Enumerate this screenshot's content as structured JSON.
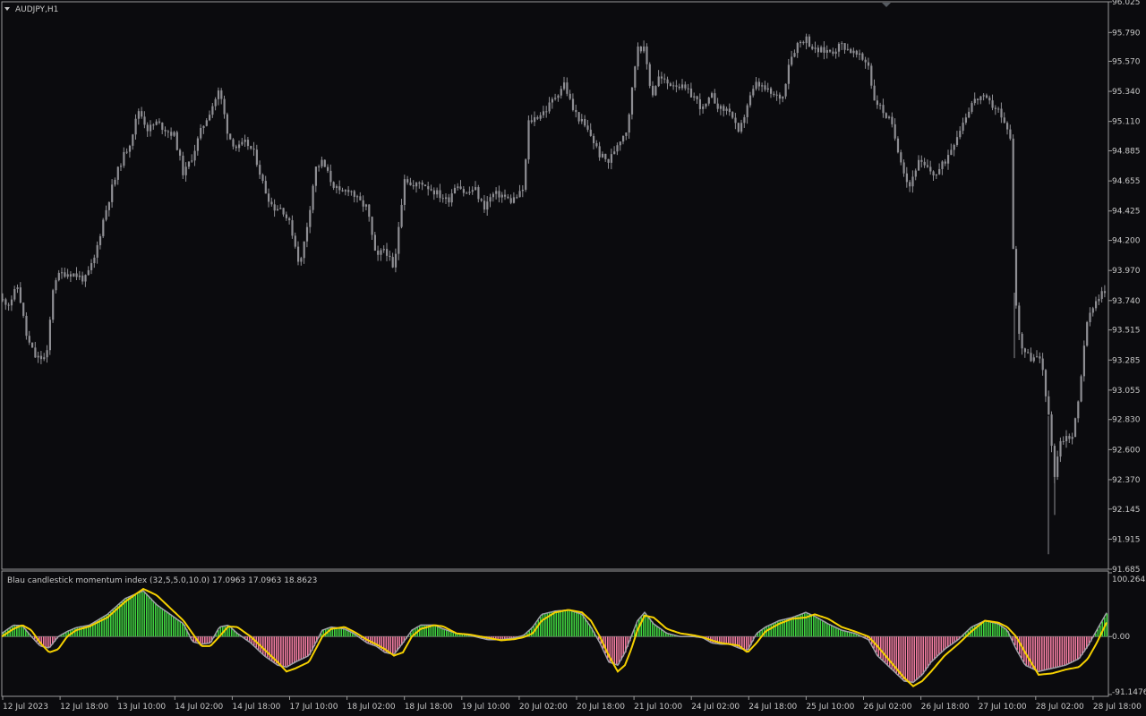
{
  "colors": {
    "background": "#0b0b0e",
    "frame": "#9a9a9a",
    "candle": "#8e8e93",
    "text": "#c8c8c8",
    "hist_pos": "#3fd23f",
    "hist_neg": "#f07ca0",
    "line_main": "#a0a0a8",
    "line_signal": "#f5d000"
  },
  "header": {
    "symbol_label": "AUDJPY,H1",
    "indicator_label": "Blau candlestick momentum index (32,5,5.0,10.0) 17.0963 17.0963 18.8623"
  },
  "chart_data": [
    {
      "type": "candlestick",
      "symbol": "AUDJPY",
      "timeframe": "H1",
      "ylim": [
        91.685,
        96.025
      ],
      "y_ticks": [
        "96.025",
        "95.790",
        "95.570",
        "95.340",
        "95.110",
        "94.885",
        "94.655",
        "94.425",
        "94.200",
        "93.970",
        "93.740",
        "93.515",
        "93.285",
        "93.055",
        "92.830",
        "92.600",
        "92.370",
        "92.145",
        "91.915",
        "91.685"
      ],
      "close_path": [
        [
          0,
          93.75
        ],
        [
          10,
          93.72
        ],
        [
          20,
          93.85
        ],
        [
          30,
          93.45
        ],
        [
          40,
          93.3
        ],
        [
          52,
          93.3
        ],
        [
          60,
          93.9
        ],
        [
          70,
          93.95
        ],
        [
          80,
          93.95
        ],
        [
          95,
          93.9
        ],
        [
          105,
          94.05
        ],
        [
          115,
          94.35
        ],
        [
          125,
          94.6
        ],
        [
          135,
          94.8
        ],
        [
          145,
          94.95
        ],
        [
          155,
          95.2
        ],
        [
          165,
          95.05
        ],
        [
          175,
          95.1
        ],
        [
          185,
          95.05
        ],
        [
          195,
          95.0
        ],
        [
          205,
          94.7
        ],
        [
          215,
          94.85
        ],
        [
          225,
          95.05
        ],
        [
          235,
          95.2
        ],
        [
          245,
          95.35
        ],
        [
          255,
          95.0
        ],
        [
          265,
          94.9
        ],
        [
          275,
          94.95
        ],
        [
          285,
          94.85
        ],
        [
          295,
          94.6
        ],
        [
          305,
          94.45
        ],
        [
          315,
          94.45
        ],
        [
          325,
          94.3
        ],
        [
          335,
          94.0
        ],
        [
          345,
          94.4
        ],
        [
          352,
          94.75
        ],
        [
          360,
          94.8
        ],
        [
          370,
          94.65
        ],
        [
          380,
          94.55
        ],
        [
          390,
          94.6
        ],
        [
          400,
          94.5
        ],
        [
          410,
          94.45
        ],
        [
          420,
          94.05
        ],
        [
          430,
          94.15
        ],
        [
          440,
          93.95
        ],
        [
          445,
          94.3
        ],
        [
          452,
          94.7
        ],
        [
          460,
          94.6
        ],
        [
          470,
          94.65
        ],
        [
          480,
          94.6
        ],
        [
          490,
          94.55
        ],
        [
          500,
          94.5
        ],
        [
          510,
          94.65
        ],
        [
          520,
          94.55
        ],
        [
          530,
          94.6
        ],
        [
          540,
          94.45
        ],
        [
          550,
          94.55
        ],
        [
          560,
          94.55
        ],
        [
          570,
          94.5
        ],
        [
          580,
          94.55
        ],
        [
          585,
          94.6
        ],
        [
          590,
          95.1
        ],
        [
          600,
          95.15
        ],
        [
          610,
          95.2
        ],
        [
          620,
          95.3
        ],
        [
          630,
          95.4
        ],
        [
          640,
          95.2
        ],
        [
          650,
          95.1
        ],
        [
          660,
          95.0
        ],
        [
          670,
          94.85
        ],
        [
          680,
          94.8
        ],
        [
          690,
          94.95
        ],
        [
          700,
          95.05
        ],
        [
          705,
          95.3
        ],
        [
          712,
          95.7
        ],
        [
          720,
          95.65
        ],
        [
          728,
          95.3
        ],
        [
          735,
          95.45
        ],
        [
          745,
          95.4
        ],
        [
          755,
          95.4
        ],
        [
          765,
          95.35
        ],
        [
          775,
          95.3
        ],
        [
          785,
          95.2
        ],
        [
          795,
          95.3
        ],
        [
          805,
          95.2
        ],
        [
          815,
          95.2
        ],
        [
          825,
          95.0
        ],
        [
          835,
          95.25
        ],
        [
          845,
          95.4
        ],
        [
          855,
          95.35
        ],
        [
          865,
          95.3
        ],
        [
          875,
          95.3
        ],
        [
          880,
          95.55
        ],
        [
          890,
          95.7
        ],
        [
          900,
          95.75
        ],
        [
          910,
          95.65
        ],
        [
          920,
          95.65
        ],
        [
          930,
          95.65
        ],
        [
          940,
          95.7
        ],
        [
          950,
          95.65
        ],
        [
          960,
          95.6
        ],
        [
          970,
          95.55
        ],
        [
          975,
          95.3
        ],
        [
          985,
          95.2
        ],
        [
          995,
          95.1
        ],
        [
          1005,
          94.85
        ],
        [
          1015,
          94.6
        ],
        [
          1025,
          94.8
        ],
        [
          1035,
          94.75
        ],
        [
          1045,
          94.7
        ],
        [
          1055,
          94.8
        ],
        [
          1065,
          94.95
        ],
        [
          1075,
          95.1
        ],
        [
          1085,
          95.25
        ],
        [
          1095,
          95.3
        ],
        [
          1105,
          95.25
        ],
        [
          1115,
          95.2
        ],
        [
          1120,
          95.1
        ],
        [
          1128,
          95.05
        ],
        [
          1133,
          93.8
        ],
        [
          1140,
          93.4
        ],
        [
          1150,
          93.3
        ],
        [
          1160,
          93.3
        ],
        [
          1165,
          93.2
        ],
        [
          1172,
          92.8
        ],
        [
          1178,
          92.4
        ],
        [
          1183,
          92.65
        ],
        [
          1190,
          92.7
        ],
        [
          1198,
          92.7
        ],
        [
          1205,
          93.0
        ],
        [
          1212,
          93.5
        ],
        [
          1220,
          93.7
        ],
        [
          1230,
          93.8
        ],
        [
          1237,
          93.8
        ]
      ]
    },
    {
      "type": "histogram-line",
      "title": "Blau candlestick momentum index (32,5,5.0,10.0) 17.0963 17.0963 18.8623",
      "params": [
        32,
        5,
        5.0,
        10.0
      ],
      "values_shown": [
        17.0963,
        17.0963,
        18.8623
      ],
      "ylim": [
        -91.1476,
        100.2643
      ],
      "y_ticks": [
        "100.2643",
        "0.00",
        "-91.1476"
      ],
      "main": [
        [
          2,
          5
        ],
        [
          15,
          18
        ],
        [
          25,
          17
        ],
        [
          35,
          0
        ],
        [
          45,
          -15
        ],
        [
          55,
          -18
        ],
        [
          65,
          0
        ],
        [
          75,
          8
        ],
        [
          85,
          14
        ],
        [
          100,
          18
        ],
        [
          120,
          35
        ],
        [
          140,
          60
        ],
        [
          160,
          72
        ],
        [
          175,
          50
        ],
        [
          190,
          35
        ],
        [
          205,
          20
        ],
        [
          215,
          -8
        ],
        [
          225,
          -12
        ],
        [
          235,
          -10
        ],
        [
          245,
          15
        ],
        [
          255,
          18
        ],
        [
          265,
          5
        ],
        [
          280,
          -10
        ],
        [
          295,
          -30
        ],
        [
          310,
          -45
        ],
        [
          320,
          -48
        ],
        [
          330,
          -40
        ],
        [
          345,
          -30
        ],
        [
          360,
          10
        ],
        [
          370,
          15
        ],
        [
          385,
          12
        ],
        [
          395,
          5
        ],
        [
          410,
          -10
        ],
        [
          420,
          -15
        ],
        [
          430,
          -25
        ],
        [
          440,
          -28
        ],
        [
          450,
          -10
        ],
        [
          460,
          10
        ],
        [
          470,
          18
        ],
        [
          485,
          18
        ],
        [
          495,
          12
        ],
        [
          510,
          5
        ],
        [
          525,
          2
        ],
        [
          545,
          -5
        ],
        [
          560,
          -5
        ],
        [
          575,
          -2
        ],
        [
          585,
          2
        ],
        [
          595,
          15
        ],
        [
          605,
          35
        ],
        [
          620,
          40
        ],
        [
          635,
          42
        ],
        [
          650,
          35
        ],
        [
          660,
          15
        ],
        [
          670,
          -10
        ],
        [
          680,
          -40
        ],
        [
          690,
          -45
        ],
        [
          698,
          -25
        ],
        [
          705,
          0
        ],
        [
          712,
          25
        ],
        [
          720,
          38
        ],
        [
          730,
          20
        ],
        [
          745,
          5
        ],
        [
          760,
          0
        ],
        [
          775,
          0
        ],
        [
          785,
          -2
        ],
        [
          795,
          -10
        ],
        [
          805,
          -12
        ],
        [
          815,
          -12
        ],
        [
          825,
          -18
        ],
        [
          835,
          -22
        ],
        [
          845,
          5
        ],
        [
          855,
          15
        ],
        [
          870,
          25
        ],
        [
          885,
          30
        ],
        [
          900,
          38
        ],
        [
          910,
          32
        ],
        [
          925,
          20
        ],
        [
          940,
          10
        ],
        [
          955,
          5
        ],
        [
          970,
          -5
        ],
        [
          980,
          -30
        ],
        [
          995,
          -50
        ],
        [
          1010,
          -70
        ],
        [
          1020,
          -72
        ],
        [
          1030,
          -60
        ],
        [
          1040,
          -40
        ],
        [
          1055,
          -20
        ],
        [
          1070,
          -5
        ],
        [
          1085,
          15
        ],
        [
          1100,
          25
        ],
        [
          1115,
          20
        ],
        [
          1125,
          10
        ],
        [
          1135,
          -20
        ],
        [
          1145,
          -45
        ],
        [
          1160,
          -55
        ],
        [
          1175,
          -50
        ],
        [
          1190,
          -45
        ],
        [
          1205,
          -35
        ],
        [
          1215,
          -15
        ],
        [
          1225,
          10
        ],
        [
          1237,
          40
        ]
      ],
      "signal": [
        [
          2,
          0
        ],
        [
          15,
          12
        ],
        [
          25,
          18
        ],
        [
          35,
          10
        ],
        [
          45,
          -10
        ],
        [
          55,
          -25
        ],
        [
          65,
          -20
        ],
        [
          75,
          0
        ],
        [
          85,
          10
        ],
        [
          100,
          16
        ],
        [
          120,
          30
        ],
        [
          140,
          55
        ],
        [
          160,
          75
        ],
        [
          175,
          65
        ],
        [
          190,
          45
        ],
        [
          205,
          25
        ],
        [
          215,
          5
        ],
        [
          225,
          -15
        ],
        [
          235,
          -15
        ],
        [
          245,
          0
        ],
        [
          255,
          16
        ],
        [
          265,
          15
        ],
        [
          280,
          0
        ],
        [
          295,
          -20
        ],
        [
          310,
          -40
        ],
        [
          320,
          -55
        ],
        [
          330,
          -50
        ],
        [
          345,
          -40
        ],
        [
          360,
          0
        ],
        [
          370,
          12
        ],
        [
          385,
          15
        ],
        [
          395,
          8
        ],
        [
          410,
          -5
        ],
        [
          420,
          -12
        ],
        [
          430,
          -20
        ],
        [
          440,
          -30
        ],
        [
          450,
          -25
        ],
        [
          460,
          0
        ],
        [
          470,
          12
        ],
        [
          485,
          18
        ],
        [
          495,
          16
        ],
        [
          510,
          5
        ],
        [
          525,
          3
        ],
        [
          545,
          -2
        ],
        [
          560,
          -6
        ],
        [
          575,
          -4
        ],
        [
          585,
          -1
        ],
        [
          595,
          5
        ],
        [
          605,
          25
        ],
        [
          620,
          38
        ],
        [
          635,
          42
        ],
        [
          650,
          38
        ],
        [
          660,
          25
        ],
        [
          670,
          0
        ],
        [
          680,
          -30
        ],
        [
          690,
          -55
        ],
        [
          698,
          -45
        ],
        [
          705,
          -20
        ],
        [
          712,
          10
        ],
        [
          720,
          33
        ],
        [
          730,
          30
        ],
        [
          745,
          12
        ],
        [
          760,
          5
        ],
        [
          775,
          2
        ],
        [
          785,
          -1
        ],
        [
          795,
          -6
        ],
        [
          805,
          -10
        ],
        [
          815,
          -12
        ],
        [
          825,
          -14
        ],
        [
          835,
          -25
        ],
        [
          845,
          -10
        ],
        [
          855,
          8
        ],
        [
          870,
          20
        ],
        [
          885,
          28
        ],
        [
          900,
          30
        ],
        [
          910,
          35
        ],
        [
          925,
          28
        ],
        [
          940,
          15
        ],
        [
          955,
          8
        ],
        [
          970,
          0
        ],
        [
          980,
          -15
        ],
        [
          995,
          -40
        ],
        [
          1010,
          -65
        ],
        [
          1020,
          -78
        ],
        [
          1030,
          -70
        ],
        [
          1040,
          -55
        ],
        [
          1055,
          -30
        ],
        [
          1070,
          -12
        ],
        [
          1085,
          8
        ],
        [
          1100,
          25
        ],
        [
          1115,
          22
        ],
        [
          1125,
          15
        ],
        [
          1135,
          0
        ],
        [
          1145,
          -25
        ],
        [
          1160,
          -60
        ],
        [
          1175,
          -58
        ],
        [
          1190,
          -52
        ],
        [
          1205,
          -48
        ],
        [
          1215,
          -35
        ],
        [
          1225,
          -10
        ],
        [
          1237,
          25
        ]
      ]
    }
  ],
  "x_axis": {
    "labels": [
      "12 Jul 2023",
      "12 Jul 18:00",
      "13 Jul 10:00",
      "14 Jul 02:00",
      "14 Jul 18:00",
      "17 Jul 10:00",
      "18 Jul 02:00",
      "18 Jul 18:00",
      "19 Jul 10:00",
      "20 Jul 02:00",
      "20 Jul 18:00",
      "21 Jul 10:00",
      "24 Jul 02:00",
      "24 Jul 18:00",
      "25 Jul 10:00",
      "26 Jul 02:00",
      "26 Jul 18:00",
      "27 Jul 10:00",
      "28 Jul 02:00",
      "28 Jul 18:00"
    ]
  }
}
